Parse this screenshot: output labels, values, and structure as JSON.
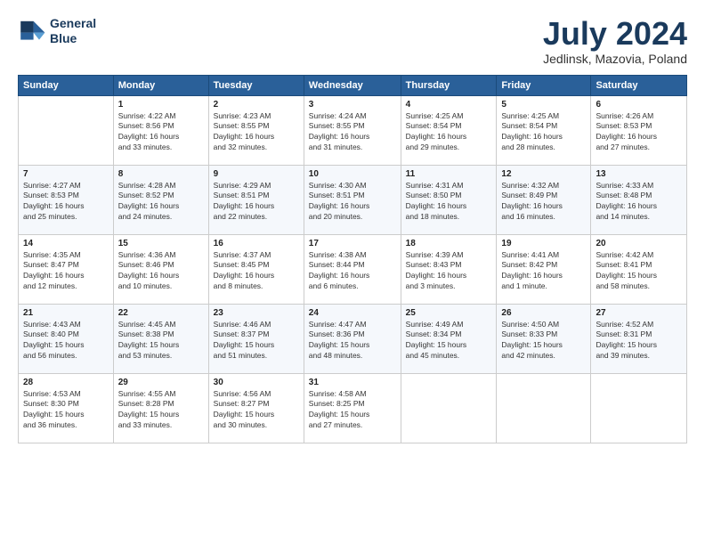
{
  "logo": {
    "line1": "General",
    "line2": "Blue"
  },
  "title": "July 2024",
  "subtitle": "Jedlinsk, Mazovia, Poland",
  "header_days": [
    "Sunday",
    "Monday",
    "Tuesday",
    "Wednesday",
    "Thursday",
    "Friday",
    "Saturday"
  ],
  "weeks": [
    [
      {
        "day": "",
        "detail": ""
      },
      {
        "day": "1",
        "detail": "Sunrise: 4:22 AM\nSunset: 8:56 PM\nDaylight: 16 hours\nand 33 minutes."
      },
      {
        "day": "2",
        "detail": "Sunrise: 4:23 AM\nSunset: 8:55 PM\nDaylight: 16 hours\nand 32 minutes."
      },
      {
        "day": "3",
        "detail": "Sunrise: 4:24 AM\nSunset: 8:55 PM\nDaylight: 16 hours\nand 31 minutes."
      },
      {
        "day": "4",
        "detail": "Sunrise: 4:25 AM\nSunset: 8:54 PM\nDaylight: 16 hours\nand 29 minutes."
      },
      {
        "day": "5",
        "detail": "Sunrise: 4:25 AM\nSunset: 8:54 PM\nDaylight: 16 hours\nand 28 minutes."
      },
      {
        "day": "6",
        "detail": "Sunrise: 4:26 AM\nSunset: 8:53 PM\nDaylight: 16 hours\nand 27 minutes."
      }
    ],
    [
      {
        "day": "7",
        "detail": "Sunrise: 4:27 AM\nSunset: 8:53 PM\nDaylight: 16 hours\nand 25 minutes."
      },
      {
        "day": "8",
        "detail": "Sunrise: 4:28 AM\nSunset: 8:52 PM\nDaylight: 16 hours\nand 24 minutes."
      },
      {
        "day": "9",
        "detail": "Sunrise: 4:29 AM\nSunset: 8:51 PM\nDaylight: 16 hours\nand 22 minutes."
      },
      {
        "day": "10",
        "detail": "Sunrise: 4:30 AM\nSunset: 8:51 PM\nDaylight: 16 hours\nand 20 minutes."
      },
      {
        "day": "11",
        "detail": "Sunrise: 4:31 AM\nSunset: 8:50 PM\nDaylight: 16 hours\nand 18 minutes."
      },
      {
        "day": "12",
        "detail": "Sunrise: 4:32 AM\nSunset: 8:49 PM\nDaylight: 16 hours\nand 16 minutes."
      },
      {
        "day": "13",
        "detail": "Sunrise: 4:33 AM\nSunset: 8:48 PM\nDaylight: 16 hours\nand 14 minutes."
      }
    ],
    [
      {
        "day": "14",
        "detail": "Sunrise: 4:35 AM\nSunset: 8:47 PM\nDaylight: 16 hours\nand 12 minutes."
      },
      {
        "day": "15",
        "detail": "Sunrise: 4:36 AM\nSunset: 8:46 PM\nDaylight: 16 hours\nand 10 minutes."
      },
      {
        "day": "16",
        "detail": "Sunrise: 4:37 AM\nSunset: 8:45 PM\nDaylight: 16 hours\nand 8 minutes."
      },
      {
        "day": "17",
        "detail": "Sunrise: 4:38 AM\nSunset: 8:44 PM\nDaylight: 16 hours\nand 6 minutes."
      },
      {
        "day": "18",
        "detail": "Sunrise: 4:39 AM\nSunset: 8:43 PM\nDaylight: 16 hours\nand 3 minutes."
      },
      {
        "day": "19",
        "detail": "Sunrise: 4:41 AM\nSunset: 8:42 PM\nDaylight: 16 hours\nand 1 minute."
      },
      {
        "day": "20",
        "detail": "Sunrise: 4:42 AM\nSunset: 8:41 PM\nDaylight: 15 hours\nand 58 minutes."
      }
    ],
    [
      {
        "day": "21",
        "detail": "Sunrise: 4:43 AM\nSunset: 8:40 PM\nDaylight: 15 hours\nand 56 minutes."
      },
      {
        "day": "22",
        "detail": "Sunrise: 4:45 AM\nSunset: 8:38 PM\nDaylight: 15 hours\nand 53 minutes."
      },
      {
        "day": "23",
        "detail": "Sunrise: 4:46 AM\nSunset: 8:37 PM\nDaylight: 15 hours\nand 51 minutes."
      },
      {
        "day": "24",
        "detail": "Sunrise: 4:47 AM\nSunset: 8:36 PM\nDaylight: 15 hours\nand 48 minutes."
      },
      {
        "day": "25",
        "detail": "Sunrise: 4:49 AM\nSunset: 8:34 PM\nDaylight: 15 hours\nand 45 minutes."
      },
      {
        "day": "26",
        "detail": "Sunrise: 4:50 AM\nSunset: 8:33 PM\nDaylight: 15 hours\nand 42 minutes."
      },
      {
        "day": "27",
        "detail": "Sunrise: 4:52 AM\nSunset: 8:31 PM\nDaylight: 15 hours\nand 39 minutes."
      }
    ],
    [
      {
        "day": "28",
        "detail": "Sunrise: 4:53 AM\nSunset: 8:30 PM\nDaylight: 15 hours\nand 36 minutes."
      },
      {
        "day": "29",
        "detail": "Sunrise: 4:55 AM\nSunset: 8:28 PM\nDaylight: 15 hours\nand 33 minutes."
      },
      {
        "day": "30",
        "detail": "Sunrise: 4:56 AM\nSunset: 8:27 PM\nDaylight: 15 hours\nand 30 minutes."
      },
      {
        "day": "31",
        "detail": "Sunrise: 4:58 AM\nSunset: 8:25 PM\nDaylight: 15 hours\nand 27 minutes."
      },
      {
        "day": "",
        "detail": ""
      },
      {
        "day": "",
        "detail": ""
      },
      {
        "day": "",
        "detail": ""
      }
    ]
  ]
}
